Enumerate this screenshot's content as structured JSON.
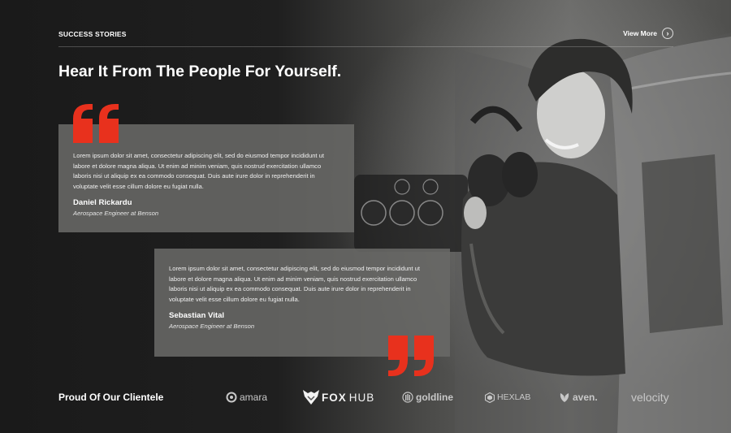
{
  "header": {
    "section_label": "SUCCESS STORIES",
    "view_more_label": "View More",
    "headline": "Hear It From The People For Yourself."
  },
  "testimonials": [
    {
      "text": "Lorem ipsum dolor sit amet, consectetur adipiscing elit, sed do eiusmod tempor incididunt ut labore et dolore magna aliqua. Ut enim ad minim veniam, quis nostrud exercitation ullamco laboris nisi ut aliquip ex ea commodo consequat. Duis aute irure dolor in reprehenderit in voluptate velit esse cillum dolore eu fugiat nulla.",
      "name": "Daniel Rickardu",
      "role": "Aerospace Engineer at Benson"
    },
    {
      "text": "Lorem ipsum dolor sit amet, consectetur adipiscing elit, sed do eiusmod tempor incididunt ut labore et dolore magna aliqua. Ut enim ad minim veniam, quis nostrud exercitation ullamco laboris nisi ut aliquip ex ea commodo consequat. Duis aute irure dolor in reprehenderit in voluptate velit esse cillum dolore eu fugiat nulla.",
      "name": "Sebastian Vital",
      "role": "Aerospace Engineer at Benson"
    }
  ],
  "clients": {
    "title": "Proud Of Our Clientele",
    "logos": [
      {
        "name": "amara",
        "icon": "ring-icon"
      },
      {
        "name_a": "FOX",
        "name_b": "HUB",
        "icon": "fox-icon"
      },
      {
        "name": "goldline",
        "icon": "bars-circle-icon"
      },
      {
        "name": "HEXLAB",
        "icon": "hexagon-icon"
      },
      {
        "name": "aven.",
        "icon": "leaf-icon"
      },
      {
        "name": "velocity"
      }
    ]
  },
  "colors": {
    "accent": "#e8311d",
    "card_bg": "#696967",
    "background": "#1c1c1c"
  }
}
